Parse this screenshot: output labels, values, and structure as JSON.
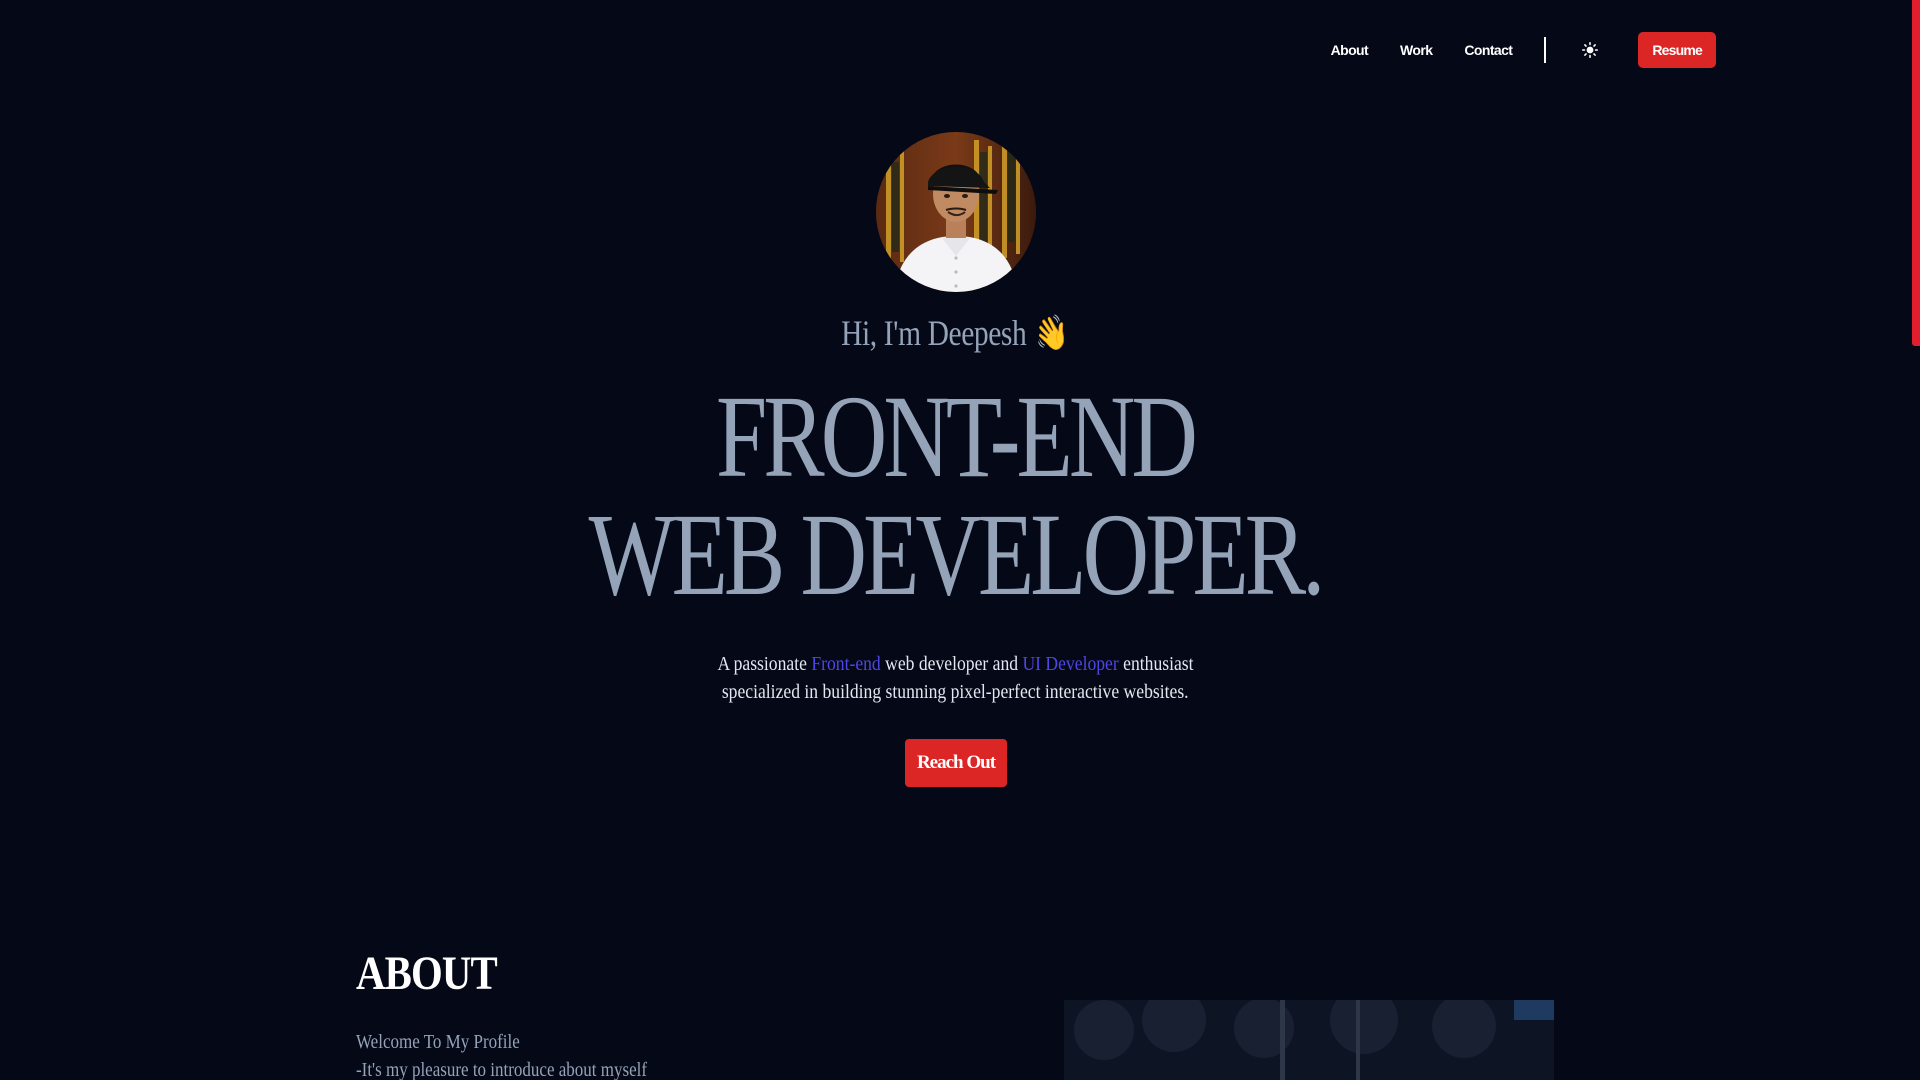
{
  "nav": {
    "links": [
      "About",
      "Work",
      "Contact"
    ],
    "theme_icon": "sun-icon",
    "resume_label": "Resume"
  },
  "hero": {
    "greeting": "Hi, I'm Deepesh",
    "wave_emoji": "👋",
    "headline_line1": "FRONT-END",
    "headline_line2": "WEB DEVELOPER.",
    "tagline": {
      "part1": "A passionate ",
      "highlight1": "Front-end",
      "part2": " web developer and ",
      "highlight2": "UI Developer",
      "part3": " enthusiast",
      "line2": "specialized in building stunning pixel-perfect interactive websites."
    },
    "cta_label": "Reach Out"
  },
  "about": {
    "title": "ABOUT",
    "line1": "Welcome To My Profile",
    "line2": "-It's my pleasure to introduce about myself"
  },
  "colors": {
    "background": "#050816",
    "accent_red": "#dc2626",
    "muted_text": "#94a3b8",
    "highlight": "#4f46e5"
  }
}
